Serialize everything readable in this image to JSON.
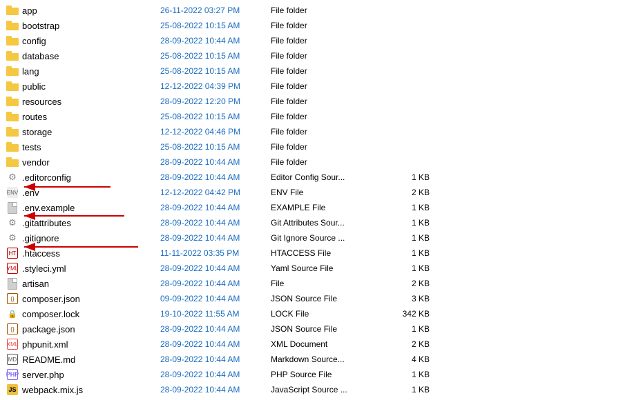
{
  "files": [
    {
      "name": "app",
      "date": "26-11-2022 03:27 PM",
      "type": "File folder",
      "size": "",
      "icon": "folder"
    },
    {
      "name": "bootstrap",
      "date": "25-08-2022 10:15 AM",
      "type": "File folder",
      "size": "",
      "icon": "folder"
    },
    {
      "name": "config",
      "date": "28-09-2022 10:44 AM",
      "type": "File folder",
      "size": "",
      "icon": "folder"
    },
    {
      "name": "database",
      "date": "25-08-2022 10:15 AM",
      "type": "File folder",
      "size": "",
      "icon": "folder"
    },
    {
      "name": "lang",
      "date": "25-08-2022 10:15 AM",
      "type": "File folder",
      "size": "",
      "icon": "folder"
    },
    {
      "name": "public",
      "date": "12-12-2022 04:39 PM",
      "type": "File folder",
      "size": "",
      "icon": "folder"
    },
    {
      "name": "resources",
      "date": "28-09-2022 12:20 PM",
      "type": "File folder",
      "size": "",
      "icon": "folder"
    },
    {
      "name": "routes",
      "date": "25-08-2022 10:15 AM",
      "type": "File folder",
      "size": "",
      "icon": "folder"
    },
    {
      "name": "storage",
      "date": "12-12-2022 04:46 PM",
      "type": "File folder",
      "size": "",
      "icon": "folder"
    },
    {
      "name": "tests",
      "date": "25-08-2022 10:15 AM",
      "type": "File folder",
      "size": "",
      "icon": "folder"
    },
    {
      "name": "vendor",
      "date": "28-09-2022 10:44 AM",
      "type": "File folder",
      "size": "",
      "icon": "folder"
    },
    {
      "name": ".editorconfig",
      "date": "28-09-2022 10:44 AM",
      "type": "Editor Config Sour...",
      "size": "1 KB",
      "icon": "gear"
    },
    {
      "name": ".env",
      "date": "12-12-2022 04:42 PM",
      "type": "ENV File",
      "size": "2 KB",
      "icon": "env"
    },
    {
      "name": ".env.example",
      "date": "28-09-2022 10:44 AM",
      "type": "EXAMPLE File",
      "size": "1 KB",
      "icon": "file"
    },
    {
      "name": ".gitattributes",
      "date": "28-09-2022 10:44 AM",
      "type": "Git Attributes Sour...",
      "size": "1 KB",
      "icon": "gear"
    },
    {
      "name": ".gitignore",
      "date": "28-09-2022 10:44 AM",
      "type": "Git Ignore Source ...",
      "size": "1 KB",
      "icon": "gear"
    },
    {
      "name": ".htaccess",
      "date": "11-11-2022 03:35 PM",
      "type": "HTACCESS File",
      "size": "1 KB",
      "icon": "htaccess"
    },
    {
      "name": ".styleci.yml",
      "date": "28-09-2022 10:44 AM",
      "type": "Yaml Source File",
      "size": "1 KB",
      "icon": "yaml"
    },
    {
      "name": "artisan",
      "date": "28-09-2022 10:44 AM",
      "type": "File",
      "size": "2 KB",
      "icon": "file"
    },
    {
      "name": "composer.json",
      "date": "09-09-2022 10:44 AM",
      "type": "JSON Source File",
      "size": "3 KB",
      "icon": "json"
    },
    {
      "name": "composer.lock",
      "date": "19-10-2022 11:55 AM",
      "type": "LOCK File",
      "size": "342 KB",
      "icon": "lock"
    },
    {
      "name": "package.json",
      "date": "28-09-2022 10:44 AM",
      "type": "JSON Source File",
      "size": "1 KB",
      "icon": "json"
    },
    {
      "name": "phpunit.xml",
      "date": "28-09-2022 10:44 AM",
      "type": "XML Document",
      "size": "2 KB",
      "icon": "xml"
    },
    {
      "name": "README.md",
      "date": "28-09-2022 10:44 AM",
      "type": "Markdown Source...",
      "size": "4 KB",
      "icon": "md"
    },
    {
      "name": "server.php",
      "date": "28-09-2022 10:44 AM",
      "type": "PHP Source File",
      "size": "1 KB",
      "icon": "php"
    },
    {
      "name": "webpack.mix.js",
      "date": "28-09-2022 10:44 AM",
      "type": "JavaScript Source ...",
      "size": "1 KB",
      "icon": "js"
    }
  ],
  "arrows": [
    {
      "id": "arrow1",
      "from": "env-row",
      "label": "arrow to .env"
    },
    {
      "id": "arrow2",
      "from": "gitattributes-row",
      "label": "arrow to .gitattributes"
    },
    {
      "id": "arrow3",
      "from": "htaccess-row",
      "label": "arrow to .htaccess"
    }
  ]
}
